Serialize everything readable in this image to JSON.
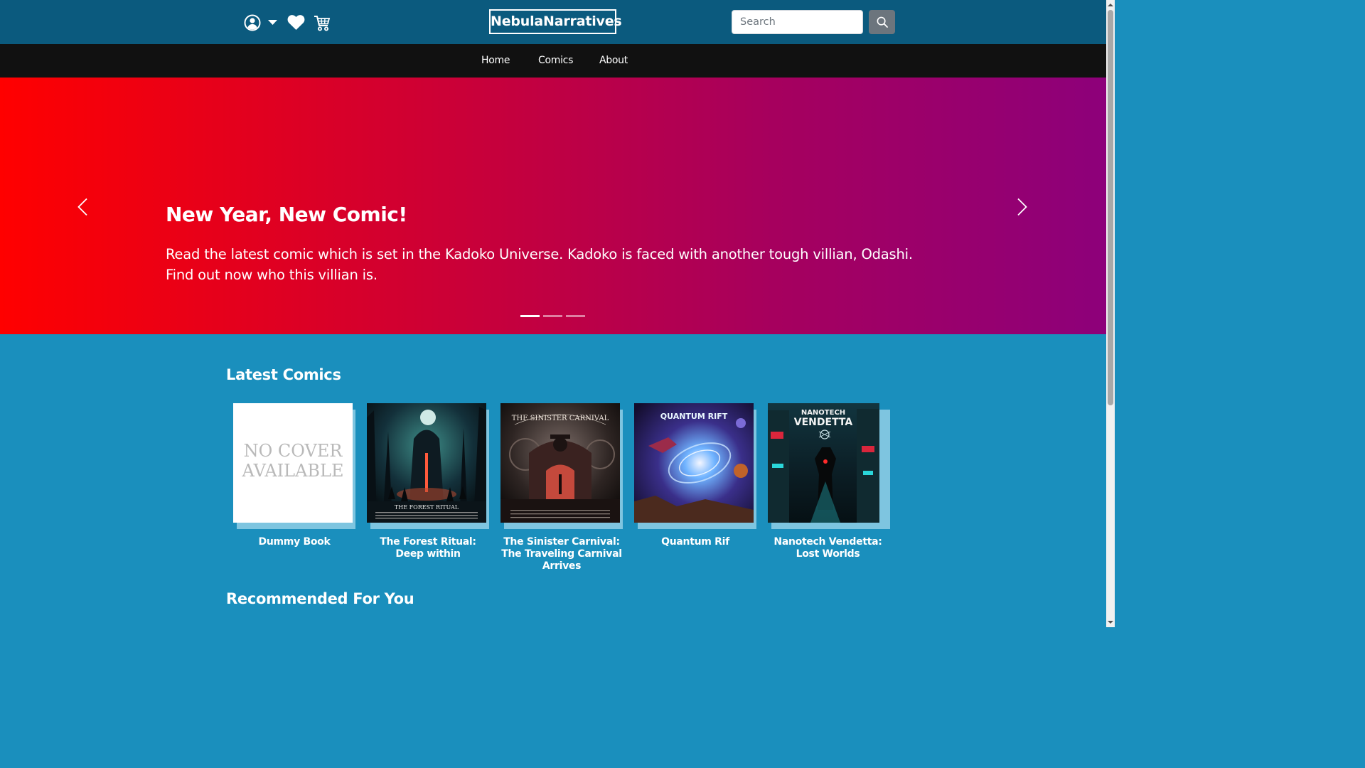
{
  "header": {
    "brand": "NebulaNarratives",
    "search": {
      "placeholder": "Search",
      "value": ""
    },
    "icons": [
      "user-icon",
      "caret-down-icon",
      "heart-icon",
      "cart-icon",
      "search-icon"
    ]
  },
  "nav": {
    "items": [
      "Home",
      "Comics",
      "About"
    ]
  },
  "carousel": {
    "title": "New Year, New Comic!",
    "text": "Read the latest comic which is set in the Kadoko Universe. Kadoko is faced with another tough villian, Odashi. Find out now who this villian is.",
    "slide_count": 3,
    "active_slide": 1
  },
  "latest": {
    "title": "Latest Comics",
    "comics": [
      {
        "title": "Dummy Book",
        "cover_text": "NO COVER AVAILABLE"
      },
      {
        "title": "The Forest Ritual: Deep within",
        "cover_text": "THE FOREST RITUAL"
      },
      {
        "title": "The Sinister Carnival: The Traveling Carnival Arrives",
        "cover_text": "THE SINISTER CARNIVAL"
      },
      {
        "title": "Quantum Rif",
        "cover_text": "QUANTUM RIFT"
      },
      {
        "title": "Nanotech Vendetta: Lost Worlds",
        "cover_text": "NANOTECH VENDETTA"
      }
    ]
  },
  "recommended": {
    "title": "Recommended For You"
  },
  "colors": {
    "header_bg": "#0b5a7e",
    "nav_bg": "#111111",
    "page_bg": "#1a8fbd",
    "carousel_start": "#ff0000",
    "carousel_end": "#8d007a"
  }
}
